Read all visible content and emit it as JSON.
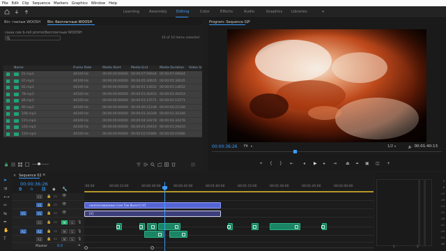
{
  "menu": [
    "File",
    "Edit",
    "Clip",
    "Sequence",
    "Markers",
    "Graphics",
    "Window",
    "Help"
  ],
  "workspaces": [
    "Learning",
    "Assembly",
    "Editing",
    "Color",
    "Effects",
    "Audio",
    "Graphics",
    "Libraries"
  ],
  "active_workspace": "Editing",
  "more_workspaces": "»",
  "bin": {
    "tabs": [
      "Bin: гнилые WOOSH",
      "Bin: бесплатные WOOSH"
    ],
    "path": "саша cee b-roll promo\\бесплатные WOOSH",
    "selection": "10 of 10 items selected",
    "columns": [
      "Name",
      "Frame Rate",
      "Media Start",
      "Media End",
      "Media Duration",
      "Video In"
    ],
    "rows": [
      {
        "name": "01.mp3",
        "rate": "44100 Hz",
        "start": "00:00:00:00000",
        "end": "00:00:07:06644",
        "dur": "00:00:07:06644"
      },
      {
        "name": "07.mp3",
        "rate": "44100 Hz",
        "start": "00:00:00:00000",
        "end": "00:00:05:30635",
        "dur": "00:00:05:30635"
      },
      {
        "name": "02.mp3",
        "rate": "44100 Hz",
        "start": "00:00:00:00000",
        "end": "00:00:01:14652",
        "dur": "00:00:01:14652"
      },
      {
        "name": "78.mp3",
        "rate": "44100 Hz",
        "start": "00:00:00:00000",
        "end": "00:00:01:40453",
        "dur": "00:00:01:40453"
      },
      {
        "name": "84.mp3",
        "rate": "44100 Hz",
        "start": "00:00:00:00000",
        "end": "00:00:01:12571",
        "dur": "00:00:01:12571"
      },
      {
        "name": "95.mp3",
        "rate": "44100 Hz",
        "start": "00:00:00:00000",
        "end": "00:00:00:21248",
        "dur": "00:00:00:21248"
      },
      {
        "name": "106.mp3",
        "rate": "44100 Hz",
        "start": "00:00:00:00000",
        "end": "00:00:01:34349",
        "dur": "00:00:01:34349"
      },
      {
        "name": "115.mp3",
        "rate": "44100 Hz",
        "start": "00:00:00:00000",
        "end": "00:00:04:34278",
        "dur": "00:00:04:34278"
      },
      {
        "name": "124.mp3",
        "rate": "44100 Hz",
        "start": "00:00:00:00000",
        "end": "00:00:01:29410",
        "dur": "00:00:01:29410"
      },
      {
        "name": "129.mp3",
        "rate": "44100 Hz",
        "start": "00:00:00:00000",
        "end": "00:00:02:01880",
        "dur": "00:00:02:01880"
      }
    ]
  },
  "program": {
    "title": "Program: Sequence 02",
    "timecode": "00:00:36:26",
    "fit": "Fit",
    "resolution": "1/2",
    "duration": "00:01:40:13"
  },
  "timeline": {
    "title": "Sequence 02",
    "timecode": "00:00:36:26",
    "ruler": [
      ":00:00",
      "00:00:15:00",
      "00:00:30:00",
      "00:00:45:00",
      "00:01:00:00",
      "00:01:15:00",
      "00:01:30:00",
      "00:01:45:00",
      "00:02:00:00"
    ],
    "video_tracks": [
      "V3",
      "V2",
      "V1"
    ],
    "audio_tracks": [
      "A1",
      "A2",
      "A3"
    ],
    "master_label": "Master",
    "master_value": "0.0",
    "clip_v2": "неоплачиваемые (cee Тик Вычет) [V]",
    "clip_v1": "[V]"
  },
  "meters": {
    "scale": [
      "0",
      "-6",
      "-12",
      "-18",
      "-24",
      "-30",
      "-36",
      "-42",
      "-48",
      "-54",
      "dB"
    ],
    "labels": [
      "S",
      "S"
    ]
  },
  "colors": {
    "accent": "#3a9dff",
    "audio_clip": "#1a8464",
    "video_clip": "#5a6ad8"
  }
}
